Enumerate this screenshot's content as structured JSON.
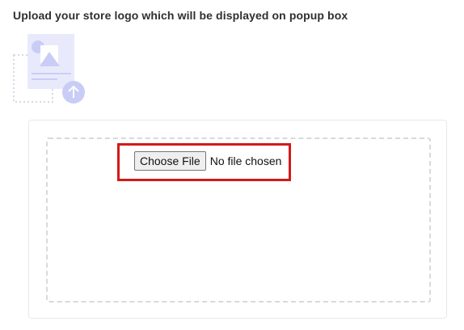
{
  "page": {
    "heading": "Upload your store logo which will be displayed on popup box"
  },
  "illustration": {
    "icon": "logo-upload-placeholder-icon",
    "arrow_icon": "upload-arrow-icon"
  },
  "file_input": {
    "button_label": "Choose File",
    "status_text": "No file chosen"
  },
  "colors": {
    "highlight_border": "#d41919",
    "illustration_primary": "#c9cdf6",
    "illustration_light": "#e8eafc",
    "dashed_border": "#d9d9d9"
  }
}
